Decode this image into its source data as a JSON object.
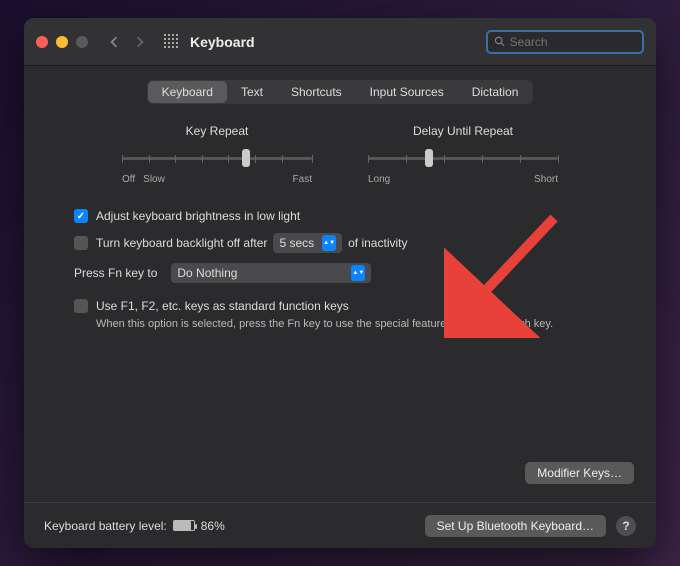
{
  "window": {
    "title": "Keyboard",
    "search_placeholder": "Search"
  },
  "tabs": [
    "Keyboard",
    "Text",
    "Shortcuts",
    "Input Sources",
    "Dictation"
  ],
  "active_tab_index": 0,
  "sliders": {
    "key_repeat": {
      "label": "Key Repeat",
      "left_label": "Off",
      "left_label2": "Slow",
      "right_label": "Fast",
      "knob_pct": 65
    },
    "delay_repeat": {
      "label": "Delay Until Repeat",
      "left_label": "Long",
      "right_label": "Short",
      "knob_pct": 32
    }
  },
  "options": {
    "adjust_brightness": {
      "label": "Adjust keyboard brightness in low light",
      "checked": true
    },
    "backlight_off": {
      "label_before": "Turn keyboard backlight off after",
      "label_after": "of inactivity",
      "value": "5 secs",
      "checked": false
    },
    "fn_key": {
      "label": "Press Fn key to",
      "value": "Do Nothing"
    },
    "function_keys": {
      "label": "Use F1, F2, etc. keys as standard function keys",
      "helper": "When this option is selected, press the Fn key to use the special features printed on each key.",
      "checked": false
    }
  },
  "buttons": {
    "modifier": "Modifier Keys…",
    "bluetooth": "Set Up Bluetooth Keyboard…"
  },
  "footer": {
    "battery_label": "Keyboard battery level:",
    "battery_pct": "86%"
  }
}
